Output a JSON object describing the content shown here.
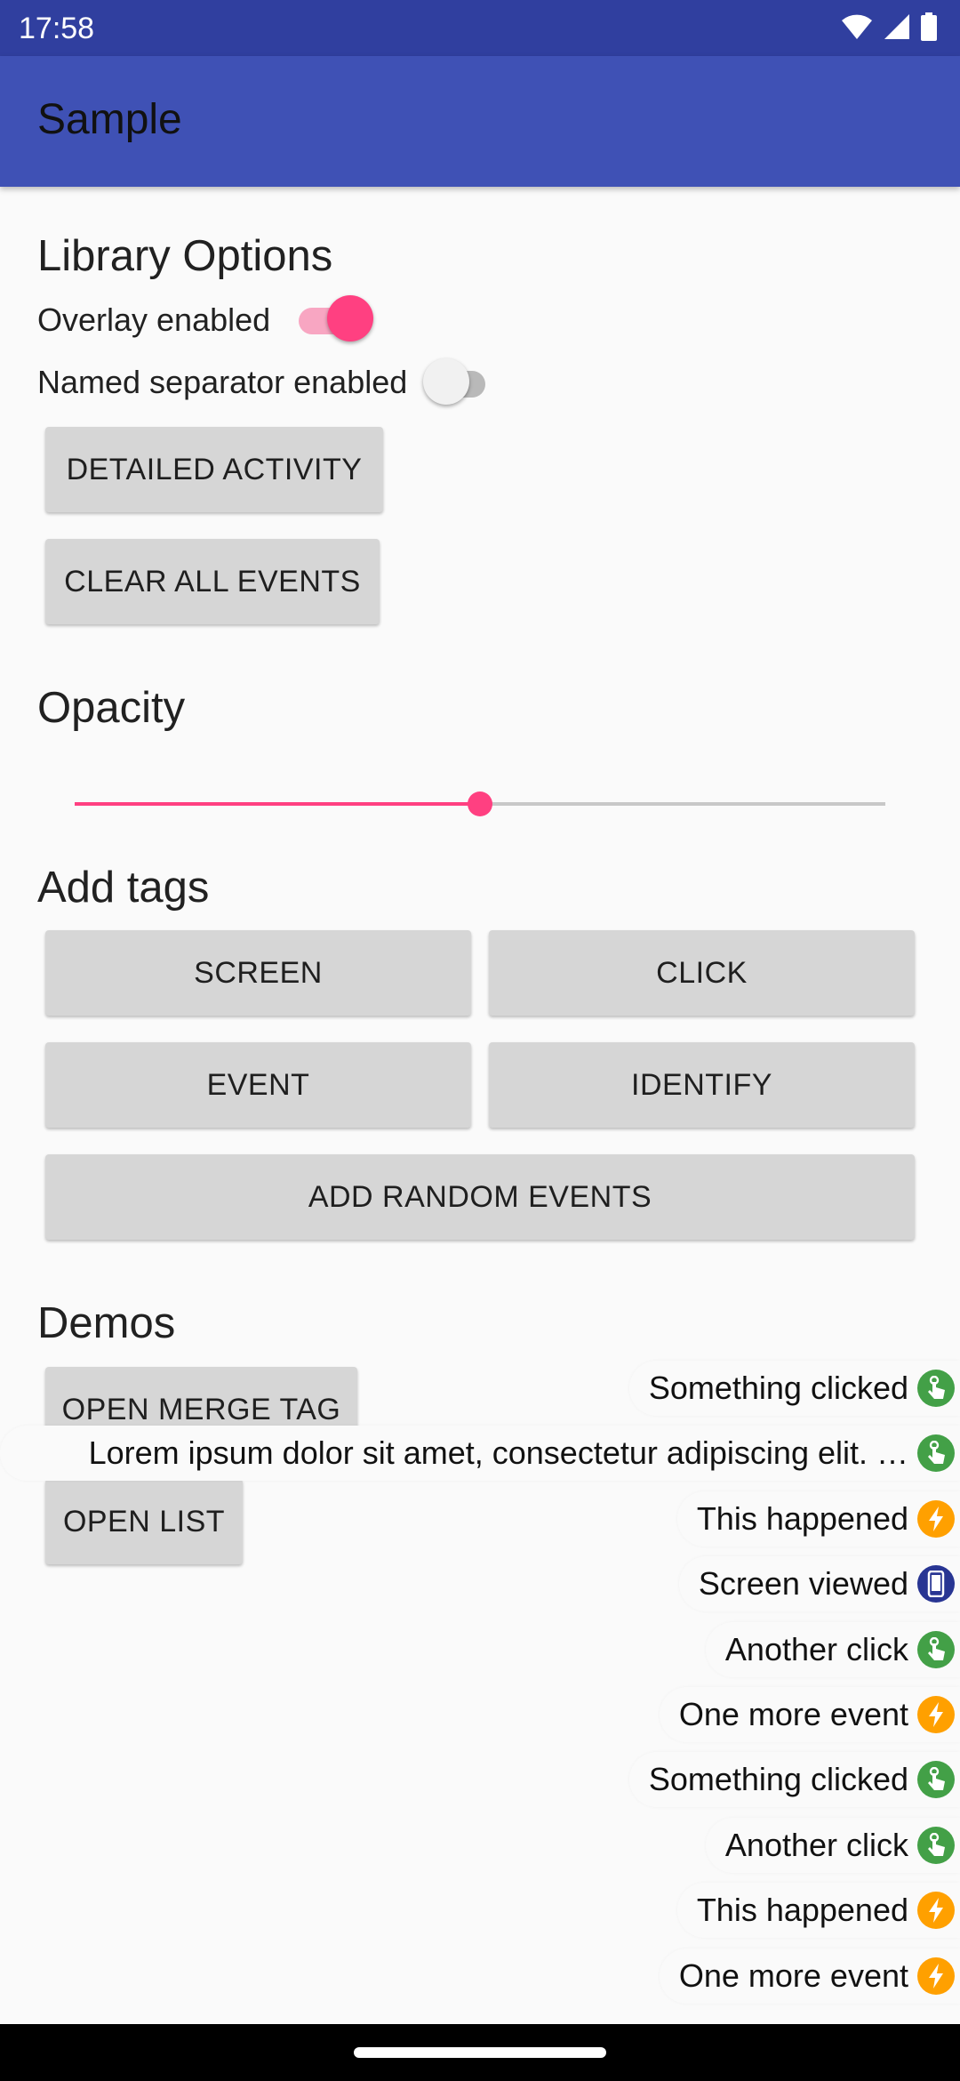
{
  "status_bar": {
    "time": "17:58",
    "icons": [
      "wifi-icon",
      "cellular-icon",
      "battery-icon"
    ]
  },
  "app_bar": {
    "title": "Sample"
  },
  "library_options": {
    "heading": "Library Options",
    "overlay_label": "Overlay enabled",
    "overlay_on": true,
    "separator_label": "Named separator enabled",
    "separator_on": false,
    "detailed_activity": "DETAILED ACTIVITY",
    "clear_all_events": "CLEAR ALL EVENTS"
  },
  "opacity": {
    "heading": "Opacity",
    "value": 0.5
  },
  "add_tags": {
    "heading": "Add tags",
    "screen": "SCREEN",
    "click": "CLICK",
    "event": "EVENT",
    "identify": "IDENTIFY",
    "add_random": "ADD RANDOM EVENTS"
  },
  "demos": {
    "heading": "Demos",
    "open_merge_tag": "OPEN MERGE TAG",
    "open_list": "OPEN LIST"
  },
  "overlay_events": [
    {
      "text": "Something clicked",
      "type": "click"
    },
    {
      "text": "Lorem ipsum dolor sit amet, consectetur adipiscing elit. …",
      "type": "click"
    },
    {
      "text": "This happened",
      "type": "event"
    },
    {
      "text": "Screen viewed",
      "type": "screen"
    },
    {
      "text": "Another click",
      "type": "click"
    },
    {
      "text": "One more event",
      "type": "event"
    },
    {
      "text": "Something clicked",
      "type": "click"
    },
    {
      "text": "Another click",
      "type": "click"
    },
    {
      "text": "This happened",
      "type": "event"
    },
    {
      "text": "One more event",
      "type": "event"
    }
  ],
  "colors": {
    "primary": "#3f51b5",
    "primary_dark": "#303f9f",
    "accent": "#ff4081",
    "click": "#43a047",
    "event": "#ffa000",
    "screen": "#283593"
  }
}
